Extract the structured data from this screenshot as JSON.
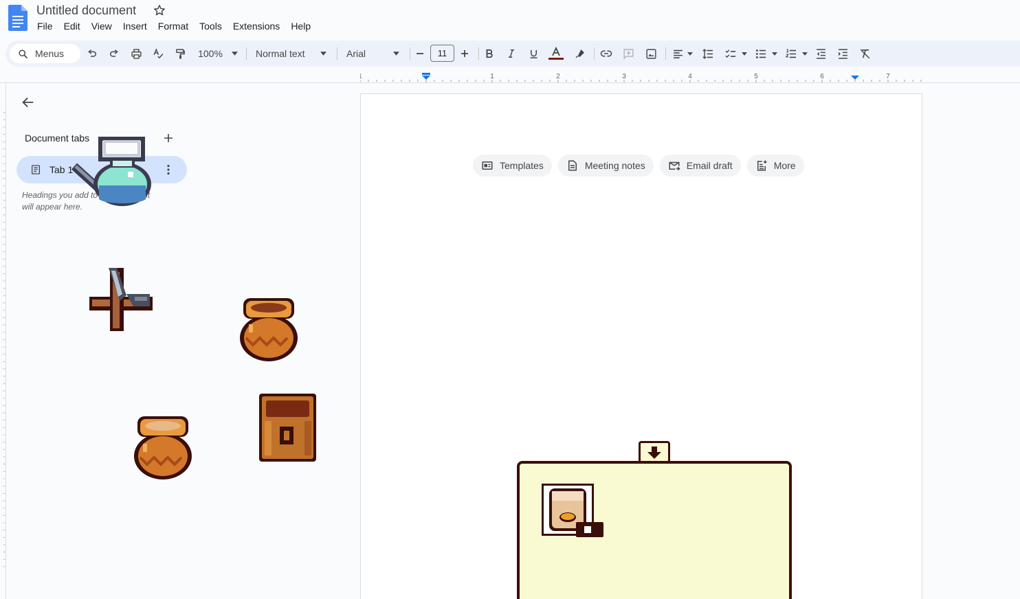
{
  "header": {
    "doc_title": "Untitled document",
    "menus": [
      "File",
      "Edit",
      "View",
      "Insert",
      "Format",
      "Tools",
      "Extensions",
      "Help"
    ]
  },
  "toolbar": {
    "menus_search_label": "Menus",
    "zoom": "100%",
    "style": "Normal text",
    "font": "Arial",
    "font_size": "11",
    "text_color": "#7b1e12"
  },
  "ruler": {
    "labels": [
      "1",
      "1",
      "2",
      "3",
      "4",
      "5",
      "6",
      "7"
    ]
  },
  "sidebar": {
    "heading": "Document tabs",
    "tab_label": "Tab 1",
    "outline_hint_line1": "Headings you add to the document",
    "outline_hint_line2": "will appear here."
  },
  "page": {
    "chips": [
      {
        "label": "Templates",
        "icon": "template-icon"
      },
      {
        "label": "Meeting notes",
        "icon": "document-icon"
      },
      {
        "label": "Email draft",
        "icon": "email-icon"
      },
      {
        "label": "More",
        "icon": "more-doc-icon"
      }
    ]
  },
  "game_overlay": {
    "sprites": [
      "watering-can",
      "pickaxe",
      "clay-pot",
      "clay-pot",
      "wooden-crate"
    ],
    "inventory_slot_item": "seed-bag"
  },
  "colors": {
    "accent_blue": "#1a73e8",
    "tab_pill": "#d3e3fd",
    "toolbar_bg": "#edf2fa",
    "panel_fill": "#fafad2",
    "panel_border": "#3a0f0a"
  }
}
